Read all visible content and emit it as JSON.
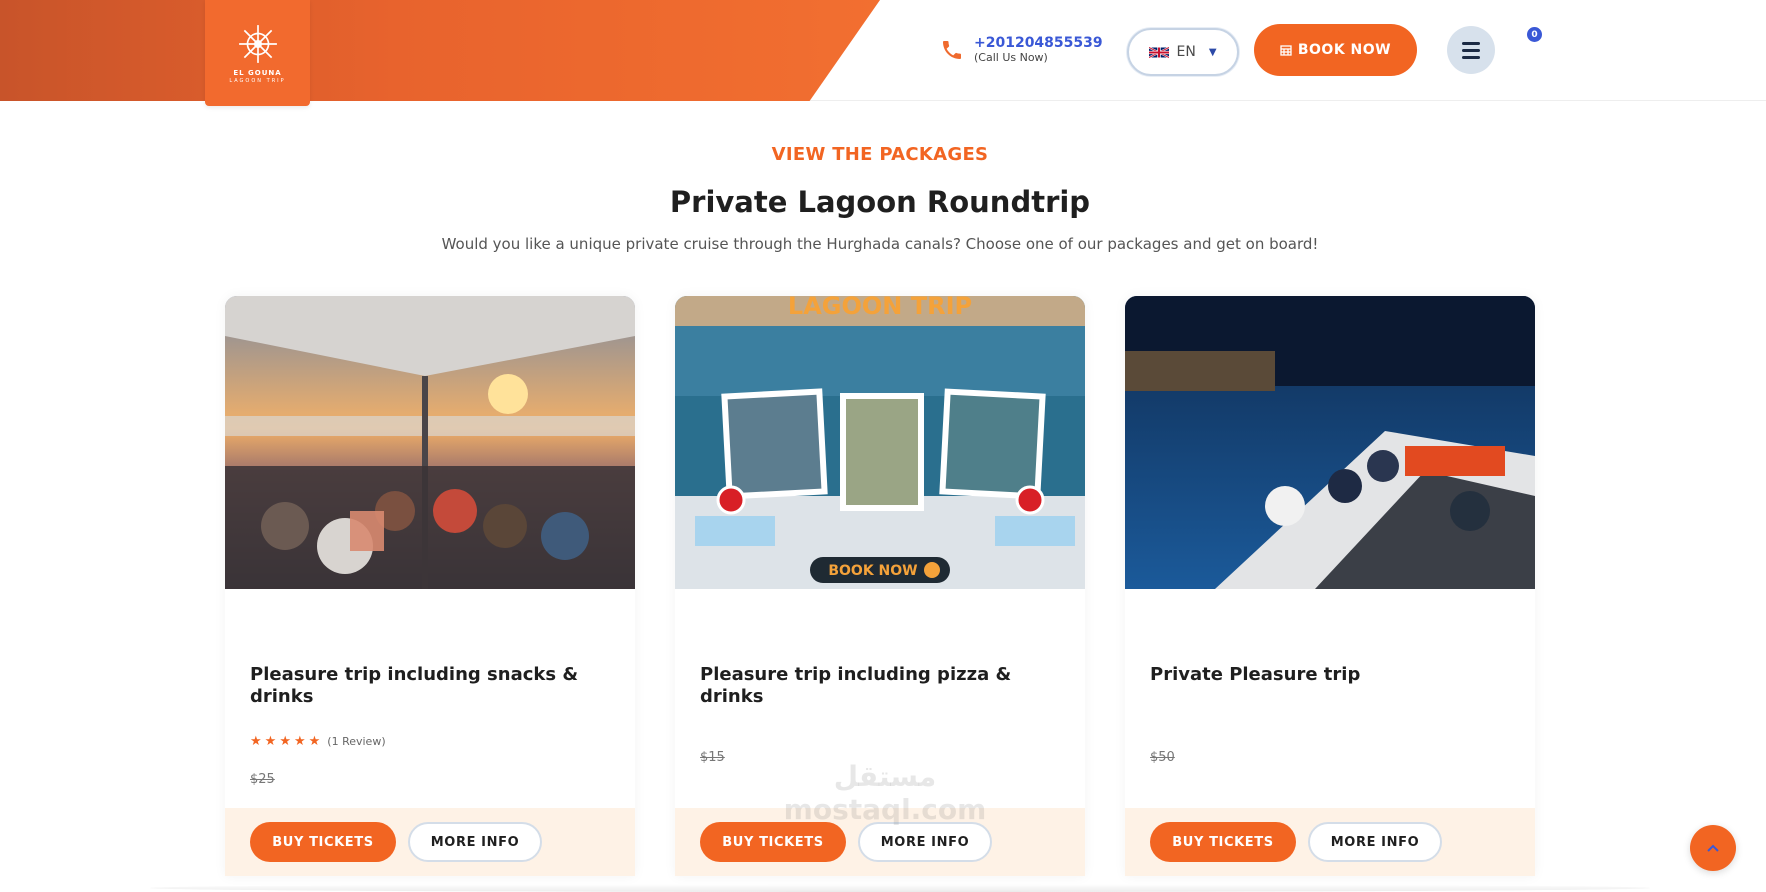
{
  "header": {
    "logo_line1": "EL GOUNA",
    "logo_line2": "LAGOON TRIP",
    "phone_number": "+201204855539",
    "phone_sub": "(Call Us Now)",
    "language": "EN",
    "book_label": "BOOK NOW",
    "cart_count": "0",
    "icons": [
      "ship-wheel-icon",
      "phone-icon",
      "uk-flag-icon",
      "calendar-icon",
      "hamburger-icon",
      "arrow-up-icon"
    ]
  },
  "section": {
    "eyebrow": "VIEW THE PACKAGES",
    "title": "Private Lagoon Roundtrip",
    "subtitle": "Would you like a unique private cruise through the Hurghada canals? Choose one of our packages and get on board!"
  },
  "cards": [
    {
      "title": "Pleasure trip including snacks & drinks",
      "rating": 5,
      "review": "(1 Review)",
      "price": "$25",
      "buy_label": "BUY TICKETS",
      "more_label": "MORE INFO"
    },
    {
      "title": "Pleasure trip including pizza & drinks",
      "price": "$15",
      "image_headline": "LAGOON TRIP",
      "image_button": "BOOK NOW",
      "buy_label": "BUY TICKETS",
      "more_label": "MORE INFO"
    },
    {
      "title": "Private Pleasure trip",
      "price": "$50",
      "buy_label": "BUY TICKETS",
      "more_label": "MORE INFO"
    }
  ],
  "watermark": "مستقل mostaql.com",
  "colors": {
    "accent": "#f26522",
    "link_blue": "#3a58d6",
    "footer_bg": "#fef2e6"
  }
}
